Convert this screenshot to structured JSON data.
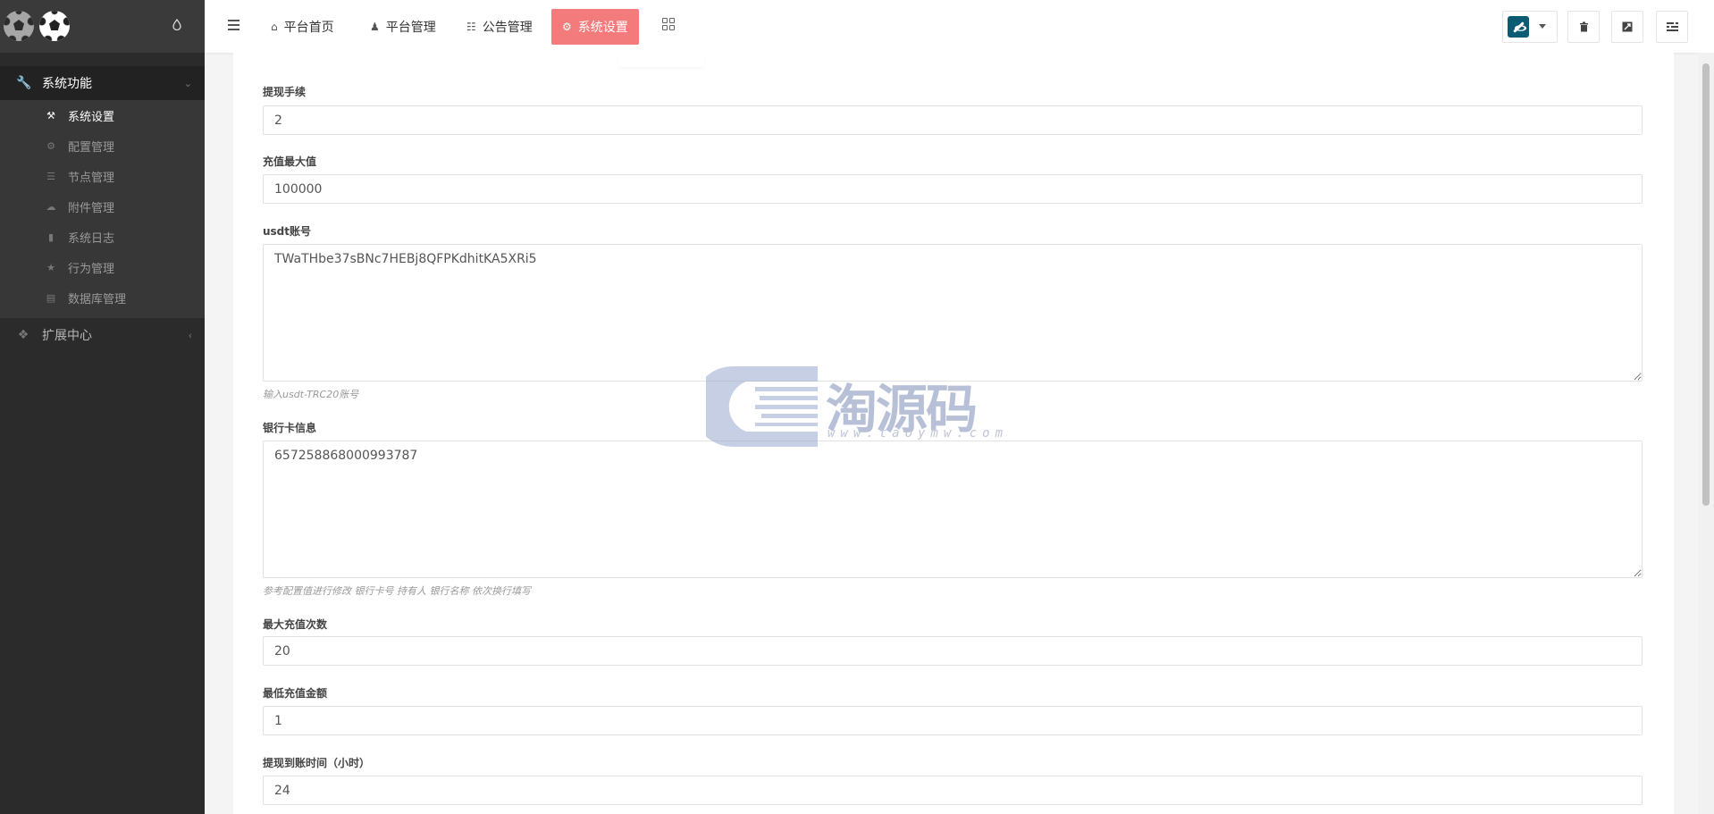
{
  "sidebar": {
    "groups": [
      {
        "label": "系统功能",
        "icon": "wrench-icon"
      },
      {
        "label": "扩展中心",
        "icon": "cubes-icon"
      }
    ],
    "items": [
      {
        "label": "系统设置",
        "icon": "wrench-icon",
        "active": true
      },
      {
        "label": "配置管理",
        "icon": "cogs-icon"
      },
      {
        "label": "节点管理",
        "icon": "list-icon"
      },
      {
        "label": "附件管理",
        "icon": "cloud-upload-icon"
      },
      {
        "label": "系统日志",
        "icon": "book-icon"
      },
      {
        "label": "行为管理",
        "icon": "star-icon"
      },
      {
        "label": "数据库管理",
        "icon": "database-icon"
      }
    ]
  },
  "topnav": {
    "items": [
      {
        "label": "平台首页",
        "icon": "home-icon"
      },
      {
        "label": "平台管理",
        "icon": "user-icon"
      },
      {
        "label": "公告管理",
        "icon": "list-alt-icon"
      },
      {
        "label": "系统设置",
        "icon": "gear-icon",
        "active": true
      }
    ]
  },
  "form": {
    "fields": [
      {
        "label": "提现手续",
        "value": "2"
      },
      {
        "label": "充值最大值",
        "value": "100000"
      },
      {
        "label": "usdt账号",
        "value": "TWaTHbe37sBNc7HEBj8QFPKdhitKA5XRi5",
        "help": "输入usdt-TRC20账号"
      },
      {
        "label": "银行卡信息",
        "value": "657258868000993787",
        "help": "参考配置值进行修改 银行卡号 持有人 银行名称 依次换行填写"
      },
      {
        "label": "最大充值次数",
        "value": "20"
      },
      {
        "label": "最低充值金额",
        "value": "1"
      },
      {
        "label": "提现到账时间（小时）",
        "value": "24"
      }
    ]
  },
  "watermark": {
    "text": "淘源码",
    "url": "www.taoymw.com"
  },
  "colors": {
    "active_tab": "#f37b7b",
    "sidebar_bg": "#2b2b2b"
  }
}
